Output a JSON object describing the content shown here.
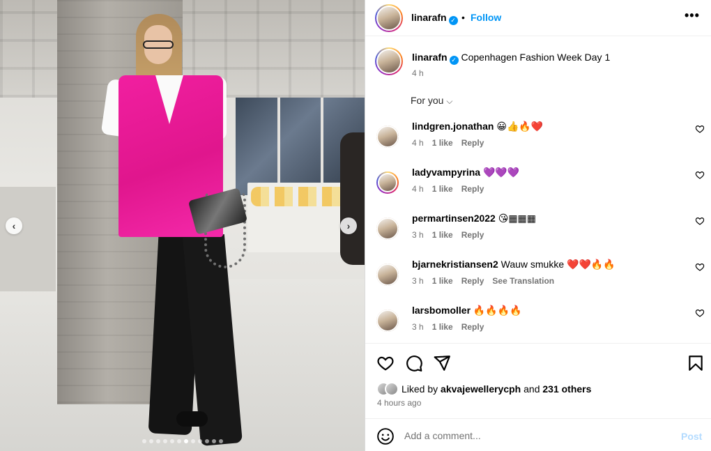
{
  "post": {
    "author": "linarafn",
    "separator": "•",
    "follow_label": "Follow",
    "more_label": "•••",
    "verified_mark": "✓",
    "caption": "Copenhagen Fashion Week Day 1",
    "caption_time": "4 h",
    "sort_label": "For you",
    "sort_chevron": "⌵"
  },
  "media": {
    "prev_label": "‹",
    "next_label": "›",
    "dot_count": 12,
    "active_dot": 6
  },
  "comments": [
    {
      "user": "lindgren.jonathan",
      "text": "😀👍🔥❤️",
      "time": "4 h",
      "likes": "1 like",
      "reply": "Reply",
      "translate": ""
    },
    {
      "user": "ladyvampyrina",
      "text": "💜💜💜",
      "time": "4 h",
      "likes": "1 like",
      "reply": "Reply",
      "translate": ""
    },
    {
      "user": "permartinsen2022",
      "text": "😘▦▦▦",
      "time": "3 h",
      "likes": "1 like",
      "reply": "Reply",
      "translate": ""
    },
    {
      "user": "bjarnekristiansen2",
      "text": "Wauw smukke ❤️❤️🔥🔥",
      "time": "3 h",
      "likes": "1 like",
      "reply": "Reply",
      "translate": "See Translation"
    },
    {
      "user": "larsbomoller",
      "text": "🔥🔥🔥🔥",
      "time": "3 h",
      "likes": "1 like",
      "reply": "Reply",
      "translate": ""
    }
  ],
  "likes": {
    "prefix": "Liked by",
    "user": "akvajewellerycph",
    "middle": "and",
    "others": "231 others"
  },
  "posted_ago": "4 hours ago",
  "add_comment": {
    "placeholder": "Add a comment...",
    "post_label": "Post"
  },
  "colors": {
    "accent": "#0095f6",
    "post_disabled": "#b3dbff",
    "muted": "#737373"
  },
  "icons": [
    "heart-icon",
    "comment-icon",
    "share-icon",
    "bookmark-icon",
    "emoji-icon",
    "more-icon",
    "verified-icon",
    "chevron-down-icon"
  ]
}
